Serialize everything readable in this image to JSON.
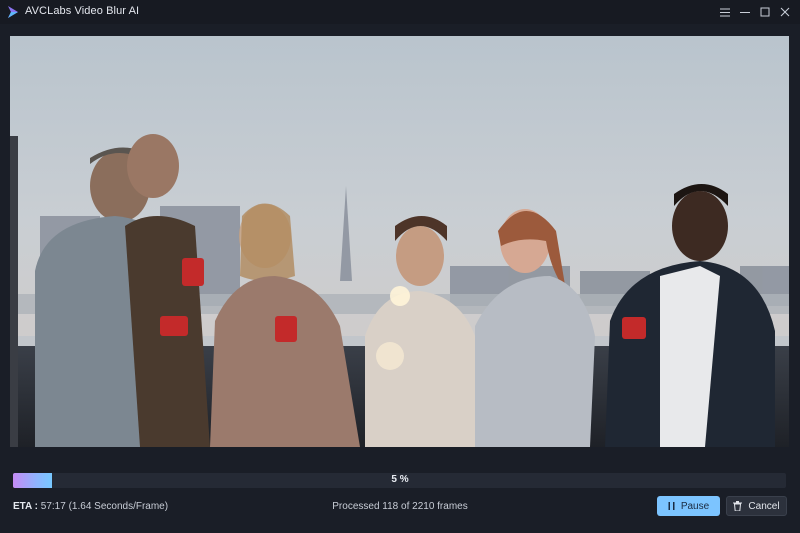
{
  "window": {
    "title": "AVCLabs Video Blur AI",
    "controls": [
      "menu",
      "minimize",
      "maximize",
      "close"
    ]
  },
  "preview": {
    "description_icons": [
      "app-logo-icon"
    ]
  },
  "progress": {
    "percent_value": 5,
    "percent_label": "5 %"
  },
  "status": {
    "eta_label": "ETA :",
    "eta_value": "57:17 (1.64 Seconds/Frame)",
    "processed_text": "Processed 118 of 2210 frames"
  },
  "buttons": {
    "pause_label": "Pause",
    "cancel_label": "Cancel"
  },
  "colors": {
    "accent": "#7cc4ff",
    "progress_start": "#c58bf5",
    "background": "#1a1e27"
  }
}
